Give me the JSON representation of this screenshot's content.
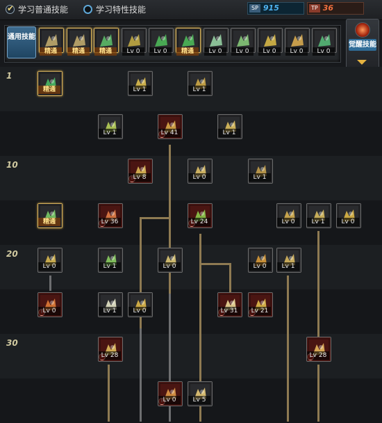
{
  "header": {
    "tab_normal": "学习普通技能",
    "tab_trait": "学习特性技能",
    "sp1_key": "SP",
    "sp1_value": "915",
    "sp2_key": "TP",
    "sp2_value": "36"
  },
  "tabs": {
    "general_label": "通用技能",
    "ultra_label": "觉醒技能",
    "skills": [
      {
        "label": "精通",
        "color": "#c8b070"
      },
      {
        "label": "精通",
        "color": "#c8b070"
      },
      {
        "label": "精通",
        "color": "#5ec26b"
      },
      {
        "label": "Lv 0",
        "color": "#c9b043"
      },
      {
        "label": "Lv 0",
        "color": "#4fbf5a"
      },
      {
        "label": "精通",
        "color": "#4fbf5a"
      },
      {
        "label": "Lv 0",
        "color": "#9bd9a8"
      },
      {
        "label": "Lv 0",
        "color": "#8ad07b"
      },
      {
        "label": "Lv 0",
        "color": "#e0c048"
      },
      {
        "label": "Lv 0",
        "color": "#e0b050"
      },
      {
        "label": "Lv 0",
        "color": "#58c17a"
      }
    ]
  },
  "tree": {
    "levels": [
      "1",
      "10",
      "20",
      "30"
    ],
    "skills": [
      {
        "label": "精通",
        "color": "#4bbf66"
      },
      {
        "label": "Lv 1",
        "color": "#e6c650"
      },
      {
        "label": "Lv 1",
        "color": "#d8b048"
      },
      {
        "label": "Lv 1",
        "color": "#bfd95a"
      },
      {
        "label": "Lv 41",
        "color": "#e0b24a"
      },
      {
        "label": "Lv 1",
        "color": "#e8c860"
      },
      {
        "label": "Lv 8",
        "color": "#e6c35a"
      },
      {
        "label": "Lv 0",
        "color": "#e8c86a"
      },
      {
        "label": "Lv 1",
        "color": "#cda64e"
      },
      {
        "label": "精通",
        "color": "#7ed36a"
      },
      {
        "label": "Lv 36",
        "color": "#e9824a"
      },
      {
        "label": "Lv 24",
        "color": "#8fd24f"
      },
      {
        "label": "Lv 0",
        "color": "#e0b852"
      },
      {
        "label": "Lv 1",
        "color": "#e2c462"
      },
      {
        "label": "Lv 0",
        "color": "#e8c048"
      },
      {
        "label": "Lv 0",
        "color": "#e2c052"
      },
      {
        "label": "Lv 1",
        "color": "#8ed661"
      },
      {
        "label": "Lv 0",
        "color": "#e8d078"
      },
      {
        "label": "Lv 0",
        "color": "#e0a038"
      },
      {
        "label": "Lv 1",
        "color": "#e2c062"
      },
      {
        "label": "Lv 0",
        "color": "#e8813a"
      },
      {
        "label": "Lv 1",
        "color": "#f0f0d0"
      },
      {
        "label": "Lv 0",
        "color": "#e8c04a"
      },
      {
        "label": "Lv 31",
        "color": "#f4e4a0"
      },
      {
        "label": "Lv 21",
        "color": "#e8c650"
      },
      {
        "label": "Lv 28",
        "color": "#e8c660"
      },
      {
        "label": "Lv 28",
        "color": "#f0c060"
      },
      {
        "label": "Lv 0",
        "color": "#e8a04a"
      },
      {
        "label": "Lv 5",
        "color": "#f2d27a"
      }
    ]
  }
}
